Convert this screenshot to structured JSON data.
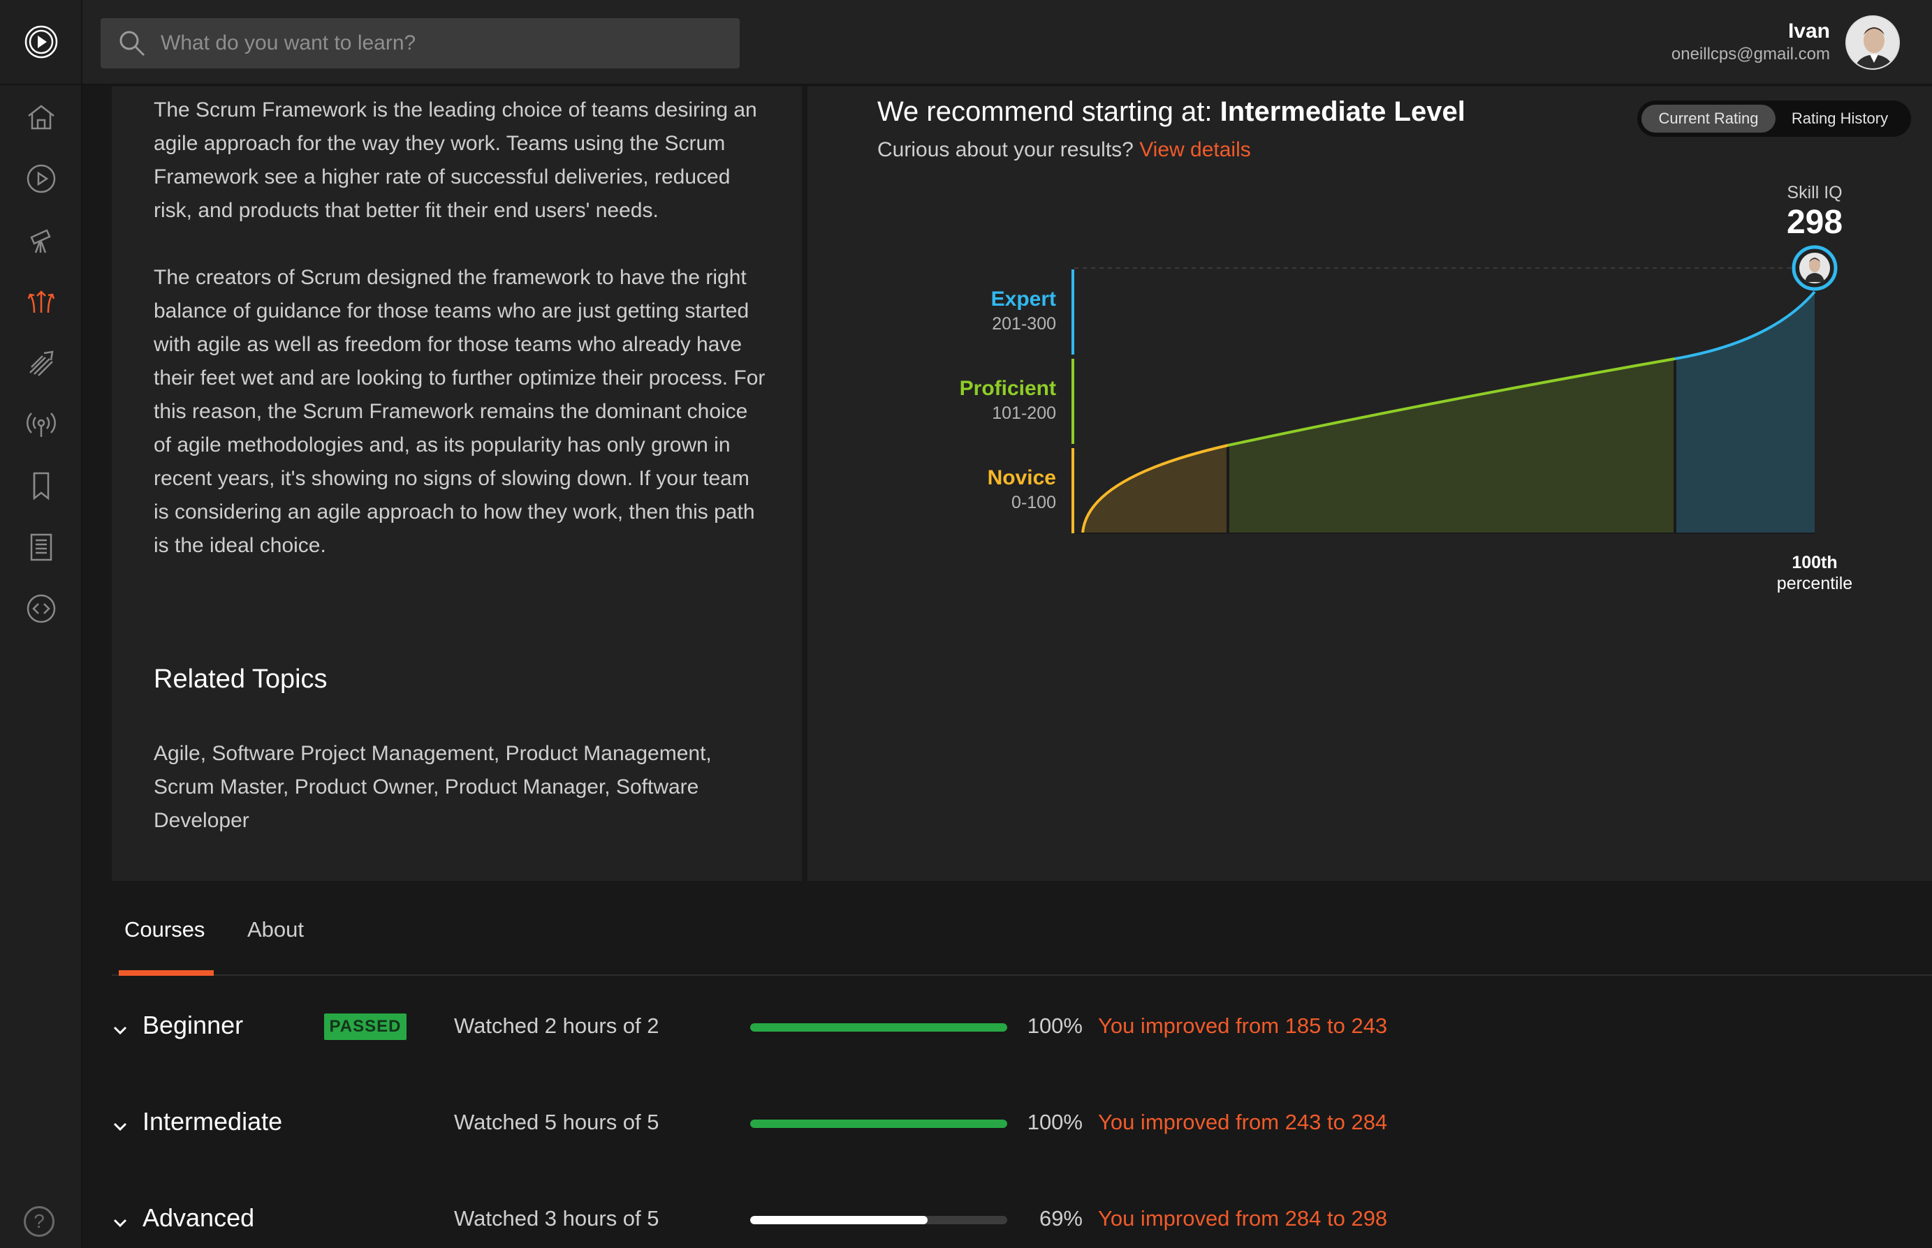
{
  "search": {
    "placeholder": "What do you want to learn?"
  },
  "user": {
    "name": "Ivan",
    "email": "oneillcps@gmail.com"
  },
  "sidebar": {
    "items": [
      {
        "icon": "home-icon"
      },
      {
        "icon": "play-icon"
      },
      {
        "icon": "telescope-icon"
      },
      {
        "icon": "paths-icon",
        "active": true
      },
      {
        "icon": "skills-icon"
      },
      {
        "icon": "broadcast-icon"
      },
      {
        "icon": "bookmark-icon"
      },
      {
        "icon": "notebook-icon"
      },
      {
        "icon": "code-icon"
      }
    ],
    "help_label": "?"
  },
  "description": {
    "paragraph1": "The Scrum Framework is the leading choice of teams desiring an agile approach for the way they work. Teams using the Scrum Framework see a higher rate of successful deliveries, reduced risk, and products that better fit their end users' needs.",
    "paragraph2": "The creators of Scrum designed the framework to have the right balance of guidance for those teams who are just getting started with agile as well as freedom for those teams who already have their feet wet and are looking to further optimize their process. For this reason, the Scrum Framework remains the dominant choice of agile methodologies and, as its popularity has only grown in recent years, it's showing no signs of slowing down. If your team is considering an agile approach to how they work, then this path is the ideal choice.",
    "related_title": "Related Topics",
    "related_text": "Agile, Software Project Management, Product Management, Scrum Master, Product Owner, Product Manager, Software Developer"
  },
  "recommendation": {
    "prefix": "We recommend starting at: ",
    "level": "Intermediate Level",
    "sub": "Curious about your results? ",
    "link": "View details",
    "toggle_current": "Current Rating",
    "toggle_history": "Rating History"
  },
  "chart_data": {
    "type": "area",
    "skill_iq_label": "Skill IQ",
    "skill_iq_value": "298",
    "percentile_label": "100th",
    "percentile_sub": "percentile",
    "bands": [
      {
        "name": "Expert",
        "range": "201-300",
        "color": "#31b9f0"
      },
      {
        "name": "Proficient",
        "range": "101-200",
        "color": "#8fce27"
      },
      {
        "name": "Novice",
        "range": "0-100",
        "color": "#f7b829"
      }
    ],
    "curve_segments": [
      {
        "band": "Novice",
        "color": "#f7b829"
      },
      {
        "band": "Proficient",
        "color": "#8fce27"
      },
      {
        "band": "Expert",
        "color": "#31b9f0"
      }
    ]
  },
  "tabs": {
    "courses": "Courses",
    "about": "About"
  },
  "courses": [
    {
      "level": "Beginner",
      "badge": "PASSED",
      "watched": "Watched 2 hours of 2",
      "progress": 100,
      "pct": "100%",
      "improved": "You improved from 185 to 243",
      "bar_color": "#27a844"
    },
    {
      "level": "Intermediate",
      "badge": "",
      "watched": "Watched 5 hours of 5",
      "progress": 100,
      "pct": "100%",
      "improved": "You improved from 243 to 284",
      "bar_color": "#27a844"
    },
    {
      "level": "Advanced",
      "badge": "",
      "watched": "Watched 3 hours of 5",
      "progress": 69,
      "pct": "69%",
      "improved": "You improved from 284 to 298",
      "bar_color": "#ffffff"
    }
  ],
  "colors": {
    "accent": "#f15b2a",
    "success": "#27a844",
    "bg": "#181818",
    "panel": "#222222"
  }
}
